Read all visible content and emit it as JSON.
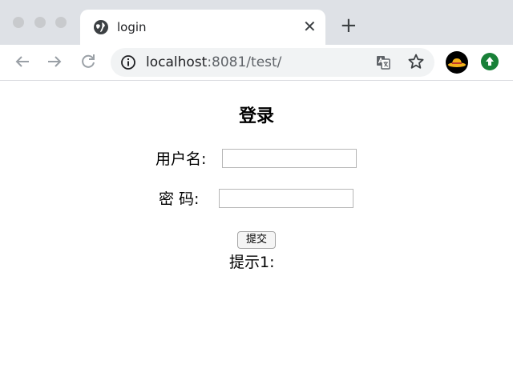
{
  "browser": {
    "tab_title": "login",
    "tab_close": "✕",
    "new_tab": "+",
    "url_host": "localhost",
    "url_rest": ":8081/test/"
  },
  "page": {
    "heading": "登录",
    "username_label": "用户名:",
    "password_label": "密 码:",
    "username_value": "",
    "password_value": "",
    "submit_label": "提交",
    "hint": "提示1:"
  }
}
